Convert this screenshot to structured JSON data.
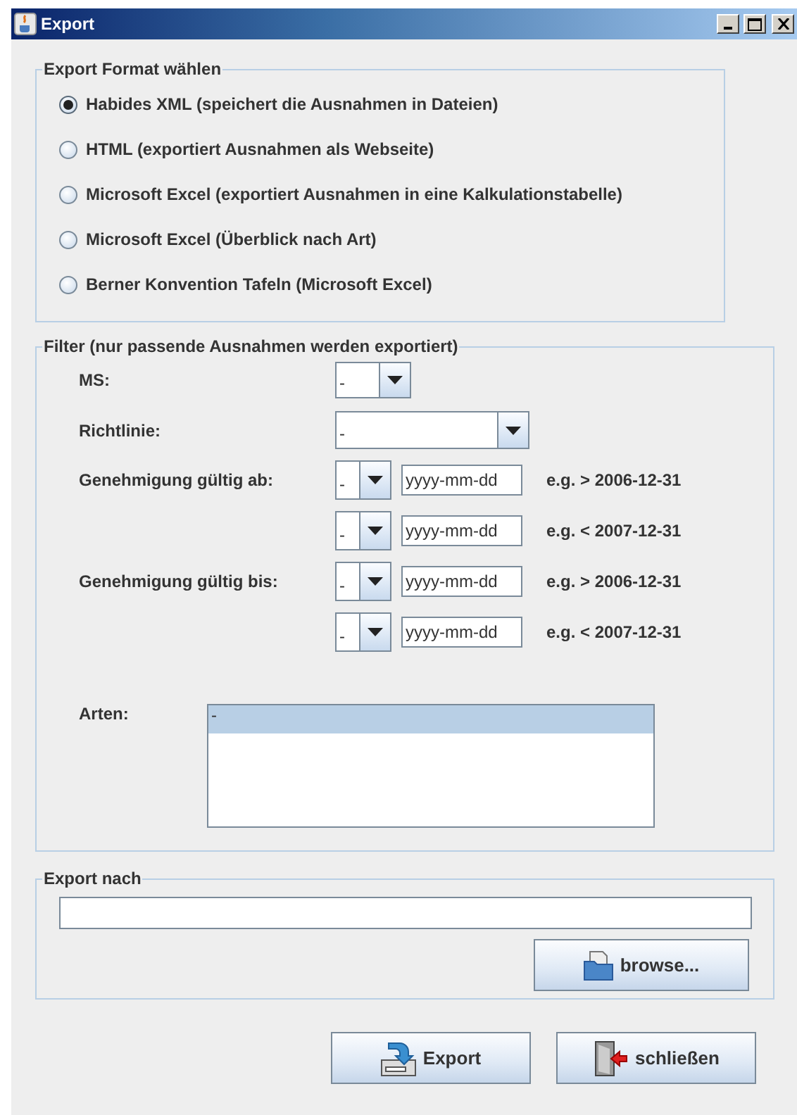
{
  "window": {
    "title": "Export"
  },
  "format_group": {
    "title": "Export Format wählen",
    "options": [
      {
        "label": "Habides XML (speichert die Ausnahmen in Dateien)",
        "selected": true
      },
      {
        "label": "HTML (exportiert Ausnahmen als Webseite)",
        "selected": false
      },
      {
        "label": "Microsoft Excel (exportiert Ausnahmen in eine Kalkulationstabelle)",
        "selected": false
      },
      {
        "label": "Microsoft Excel (Überblick nach Art)",
        "selected": false
      },
      {
        "label": "Berner Konvention Tafeln (Microsoft Excel)",
        "selected": false
      }
    ]
  },
  "filter": {
    "title": "Filter (nur passende Ausnahmen werden exportiert)",
    "ms": {
      "label": "MS:",
      "value": "-"
    },
    "richtlinie": {
      "label": "Richtlinie:",
      "value": "-"
    },
    "date_groups": [
      {
        "label": "Genehmigung gültig ab:",
        "rows": [
          {
            "operator": "-",
            "placeholder": "yyyy-mm-dd",
            "hint": "e.g. > 2006-12-31"
          },
          {
            "operator": "-",
            "placeholder": "yyyy-mm-dd",
            "hint": "e.g. < 2007-12-31"
          }
        ]
      },
      {
        "label": "Genehmigung gültig bis:",
        "rows": [
          {
            "operator": "-",
            "placeholder": "yyyy-mm-dd",
            "hint": "e.g. > 2006-12-31"
          },
          {
            "operator": "-",
            "placeholder": "yyyy-mm-dd",
            "hint": "e.g. < 2007-12-31"
          }
        ]
      }
    ],
    "arten": {
      "label": "Arten:",
      "items": [
        {
          "label": "-",
          "selected": true
        }
      ]
    }
  },
  "export_to": {
    "title": "Export nach",
    "browse": "browse..."
  },
  "buttons": [
    {
      "label": "Export",
      "kind": "export"
    },
    {
      "label": "schließen",
      "kind": "close"
    }
  ]
}
